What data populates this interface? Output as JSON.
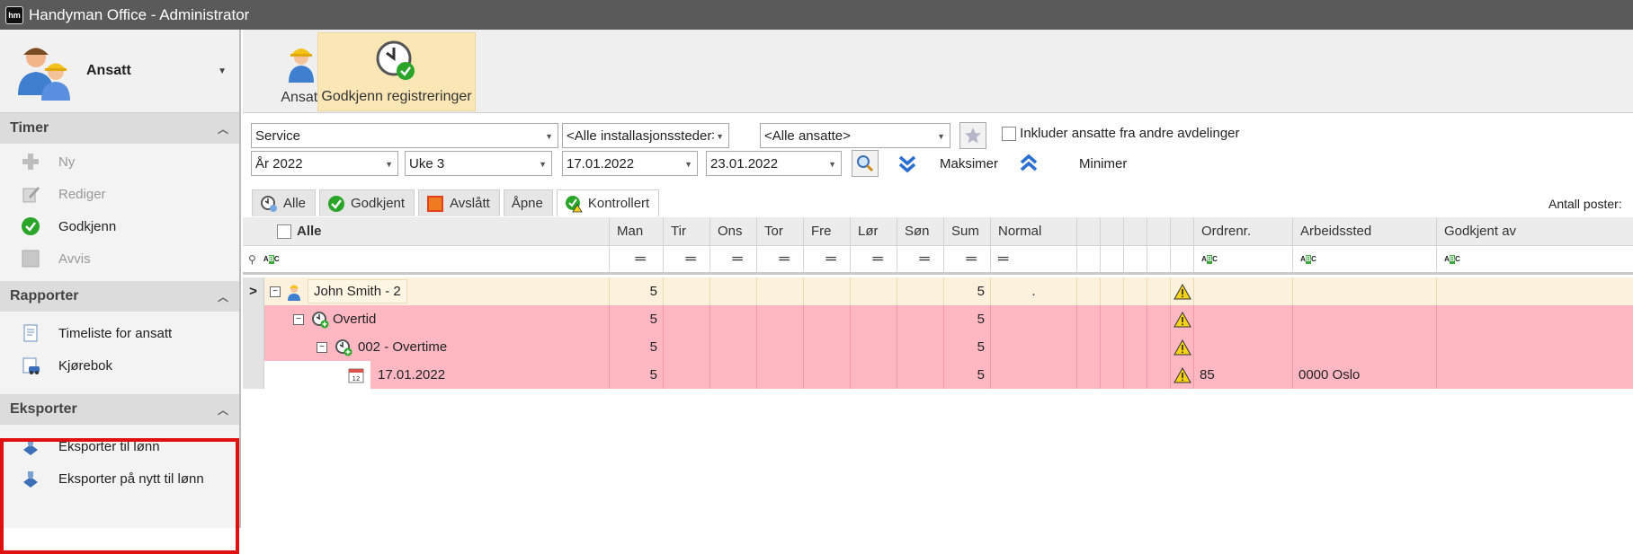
{
  "window": {
    "logo_text": "hm",
    "title": "Handyman Office - Administrator"
  },
  "sidebar": {
    "module_label": "Ansatt",
    "sections": [
      {
        "title": "Timer",
        "items": [
          {
            "label": "Ny",
            "icon": "plus-icon",
            "disabled": true
          },
          {
            "label": "Rediger",
            "icon": "edit-icon",
            "disabled": true
          },
          {
            "label": "Godkjenn",
            "icon": "check-icon",
            "disabled": false
          },
          {
            "label": "Avvis",
            "icon": "reject-icon",
            "disabled": true
          }
        ]
      },
      {
        "title": "Rapporter",
        "items": [
          {
            "label": "Timeliste for ansatt",
            "icon": "timesheet-report-icon"
          },
          {
            "label": "Kjørebok",
            "icon": "logbook-report-icon"
          }
        ]
      },
      {
        "title": "Eksporter",
        "items": [
          {
            "label": "Eksporter til lønn",
            "icon": "export-icon"
          },
          {
            "label": "Eksporter på nytt til lønn",
            "icon": "export-icon"
          }
        ]
      }
    ]
  },
  "ribbon": {
    "buttons": [
      {
        "label": "Ansatt",
        "icon": "worker-icon",
        "active": false
      },
      {
        "label": "Godkjenn registreringer",
        "icon": "clock-approve-icon",
        "active": true
      }
    ]
  },
  "filters": {
    "department": "Service",
    "location": "<Alle installasjonssteder>",
    "employees": "<Alle ansatte>",
    "include_other_label": "Inkluder ansatte fra andre avdelinger",
    "year": "År 2022",
    "week": "Uke 3",
    "date_from": "17.01.2022",
    "date_to": "23.01.2022",
    "maximize_label": "Maksimer",
    "minimize_label": "Minimer"
  },
  "tabs": [
    {
      "label": "Alle",
      "active": false
    },
    {
      "label": "Godkjent",
      "active": false
    },
    {
      "label": "Avslått",
      "active": false
    },
    {
      "label": "Åpne",
      "active": false
    },
    {
      "label": "Kontrollert",
      "active": true
    }
  ],
  "record_count_label": "Antall poster:",
  "grid": {
    "select_all_label": "Alle",
    "columns": [
      "Man",
      "Tir",
      "Ons",
      "Tor",
      "Fre",
      "Lør",
      "Søn",
      "Sum",
      "Normal",
      "",
      "",
      "",
      "",
      "",
      "Ordrenr.",
      "Arbeidssted",
      "Godkjent av"
    ],
    "rows": [
      {
        "label": "John Smith - 2",
        "level": 0,
        "type": "person",
        "man": "5",
        "sum": "5",
        "normal": ".",
        "ordrenr": "",
        "arbeidssted": ""
      },
      {
        "label": "Overtid",
        "level": 1,
        "type": "category",
        "man": "5",
        "sum": "5",
        "normal": "",
        "ordrenr": "",
        "arbeidssted": ""
      },
      {
        "label": "002 - Overtime",
        "level": 2,
        "type": "category",
        "man": "5",
        "sum": "5",
        "normal": "",
        "ordrenr": "",
        "arbeidssted": ""
      },
      {
        "label": "17.01.2022",
        "level": 3,
        "type": "entry",
        "man": "5",
        "sum": "5",
        "normal": "",
        "ordrenr": "85",
        "arbeidssted": "0000 Oslo"
      }
    ]
  }
}
